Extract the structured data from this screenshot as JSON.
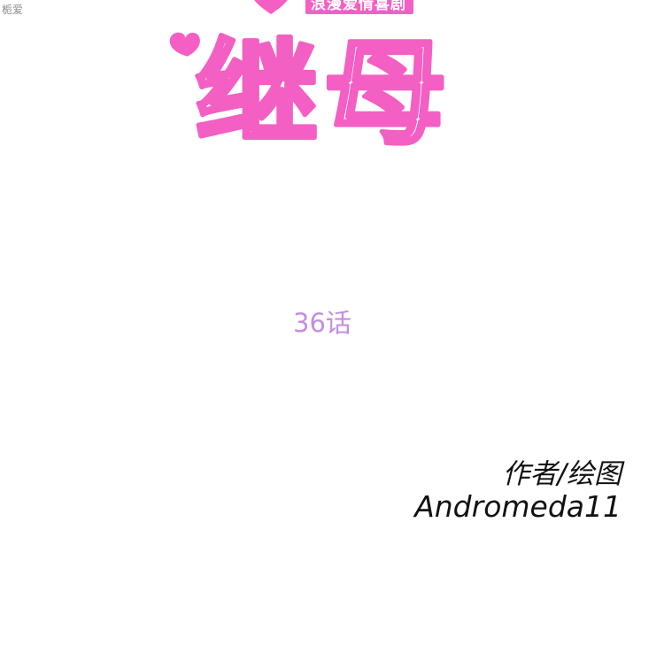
{
  "watermark": "栀爱",
  "genre_label": "浪漫爱情喜剧",
  "title": "继母",
  "episode": "36话",
  "credits": {
    "label": "作者/绘图",
    "author": "Andromeda11"
  },
  "colors": {
    "title_pink": "#f45fc4",
    "episode_purple": "#c48ee0",
    "credit_text": "#111111"
  },
  "icons": [
    "heart-icon"
  ]
}
